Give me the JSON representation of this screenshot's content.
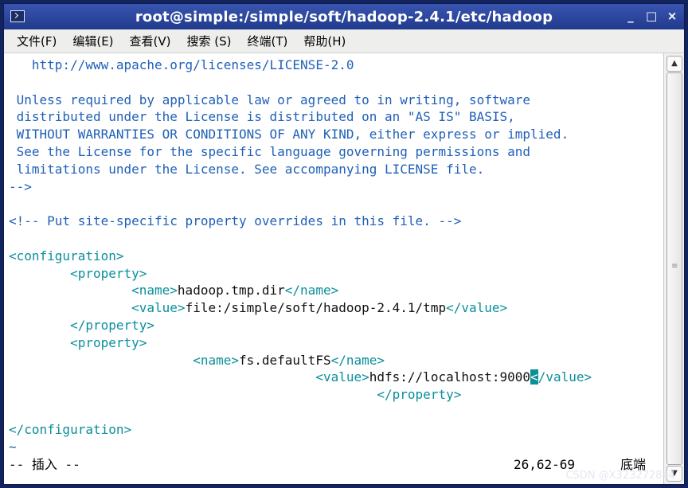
{
  "window": {
    "title": "root@simple:/simple/soft/hadoop-2.4.1/etc/hadoop"
  },
  "window_controls": {
    "minimize": "_",
    "maximize": "□",
    "close": "×"
  },
  "menu": [
    {
      "label": "文件(F)"
    },
    {
      "label": "编辑(E)"
    },
    {
      "label": "查看(V)"
    },
    {
      "label": "搜索 (S)"
    },
    {
      "label": "终端(T)"
    },
    {
      "label": "帮助(H)"
    }
  ],
  "lines": [
    [
      {
        "t": "   http://www.apache.org/licenses/LICENSE-2.0",
        "c": "cmt"
      }
    ],
    [],
    [
      {
        "t": " Unless required by applicable law or agreed to in writing, software",
        "c": "cmt"
      }
    ],
    [
      {
        "t": " distributed under the License is distributed on an \"AS IS\" BASIS,",
        "c": "cmt"
      }
    ],
    [
      {
        "t": " WITHOUT WARRANTIES OR CONDITIONS OF ANY KIND, either express or implied.",
        "c": "cmt"
      }
    ],
    [
      {
        "t": " See the License for the specific language governing permissions and",
        "c": "cmt"
      }
    ],
    [
      {
        "t": " limitations under the License. See accompanying LICENSE file.",
        "c": "cmt"
      }
    ],
    [
      {
        "t": "-->",
        "c": "cmt"
      }
    ],
    [],
    [
      {
        "t": "<!-- Put site-specific property overrides in this file. -->",
        "c": "cmt"
      }
    ],
    [],
    [
      {
        "t": "<configuration>",
        "c": "tag"
      }
    ],
    [
      {
        "t": "        "
      },
      {
        "t": "<property>",
        "c": "tag"
      }
    ],
    [
      {
        "t": "                "
      },
      {
        "t": "<name>",
        "c": "tag"
      },
      {
        "t": "hadoop.tmp.dir",
        "c": "txt"
      },
      {
        "t": "</name>",
        "c": "tag"
      }
    ],
    [
      {
        "t": "                "
      },
      {
        "t": "<value>",
        "c": "tag"
      },
      {
        "t": "file:/simple/soft/hadoop-2.4.1/tmp",
        "c": "txt"
      },
      {
        "t": "</value>",
        "c": "tag"
      }
    ],
    [
      {
        "t": "        "
      },
      {
        "t": "</property>",
        "c": "tag"
      }
    ],
    [
      {
        "t": "        "
      },
      {
        "t": "<property>",
        "c": "tag"
      }
    ],
    [
      {
        "t": "                        "
      },
      {
        "t": "<name>",
        "c": "tag"
      },
      {
        "t": "fs.defaultFS",
        "c": "txt"
      },
      {
        "t": "</name>",
        "c": "tag"
      }
    ],
    [
      {
        "t": "                                        "
      },
      {
        "t": "<value>",
        "c": "tag"
      },
      {
        "t": "hdfs://localhost:9000",
        "c": "txt"
      },
      {
        "t": "<",
        "c": "cursor"
      },
      {
        "t": "/value>",
        "c": "tag"
      }
    ],
    [
      {
        "t": "                                                "
      },
      {
        "t": "</property>",
        "c": "tag"
      }
    ],
    [],
    [
      {
        "t": "</configuration>",
        "c": "tag"
      }
    ],
    [
      {
        "t": "~",
        "c": "tilde"
      }
    ]
  ],
  "status": {
    "mode": "-- 插入 --",
    "position": "26,62-69",
    "scroll": "底端"
  },
  "watermark": "CSDN @X323272844"
}
